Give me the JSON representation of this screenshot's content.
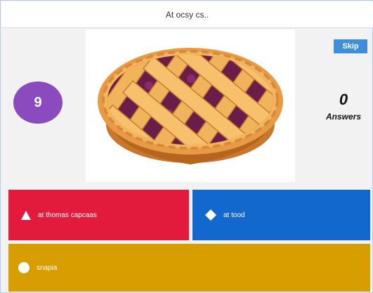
{
  "question": {
    "text": "At ocsy cs.."
  },
  "timer": {
    "value": "9"
  },
  "skip": {
    "label": "Skip"
  },
  "answers_panel": {
    "count": "0",
    "label": "Answers"
  },
  "image": {
    "subject": "lattice-pie-illustration"
  },
  "options": [
    {
      "shape": "triangle-icon",
      "color": "#e21b3c",
      "text": "at thomas capcaas"
    },
    {
      "shape": "diamond-icon",
      "color": "#1368ce",
      "text": "at tood"
    },
    {
      "shape": "circle-icon",
      "color": "#d89e00",
      "text": "snapia"
    }
  ],
  "colors": {
    "timer": "#8a4bbf",
    "skip": "#3e8fd8"
  }
}
